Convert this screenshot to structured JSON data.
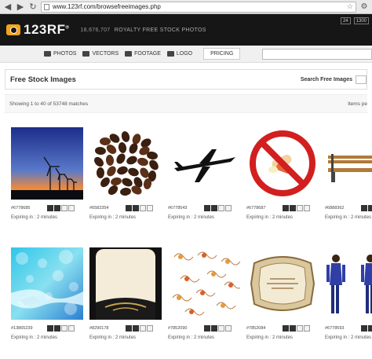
{
  "browser": {
    "url": "www.123rf.com/browsefreeimages.php"
  },
  "header": {
    "logo_text": "123RF",
    "logo_mark": "®",
    "stock_count": "18,676,707",
    "tagline": "ROYALTY FREE STOCK PHOTOS",
    "right_box_1": "24",
    "right_box_2": "1300"
  },
  "nav": {
    "items": [
      {
        "label": "PHOTOS",
        "icon": "camera-icon"
      },
      {
        "label": "VECTORS",
        "icon": "vector-icon"
      },
      {
        "label": "FOOTAGE",
        "icon": "film-icon"
      },
      {
        "label": "LOGO",
        "icon": "logo-icon"
      }
    ],
    "pricing": "PRICING"
  },
  "page": {
    "title": "Free Stock Images",
    "search_label": "Search Free Images",
    "results_text": "Showing 1 to 40 of 53748 matches",
    "items_per_page": "Items pe"
  },
  "images": [
    {
      "id": "#6778685",
      "expire": "Expiring in : 2 minutes",
      "kind": "wind-turbines"
    },
    {
      "id": "#6582354",
      "expire": "Expiring in : 2 minutes",
      "kind": "coffee-beans"
    },
    {
      "id": "#6778543",
      "expire": "Expiring in : 2 minutes",
      "kind": "airplane"
    },
    {
      "id": "#6778687",
      "expire": "Expiring in : 2 minutes",
      "kind": "no-pills"
    },
    {
      "id": "#6888362",
      "expire": "Expiring in : 2 minutes",
      "kind": "bench"
    },
    {
      "id": "#13865239",
      "expire": "Expiring in : 2 minutes",
      "kind": "bokeh-blue"
    },
    {
      "id": "#8290178",
      "expire": "Expiring in : 2 minutes",
      "kind": "gold-frame"
    },
    {
      "id": "#7852090",
      "expire": "Expiring in : 2 minutes",
      "kind": "floral"
    },
    {
      "id": "#7852084",
      "expire": "Expiring in : 2 minutes",
      "kind": "vintage-label"
    },
    {
      "id": "#6778593",
      "expire": "Expiring in : 2 minutes",
      "kind": "businesswomen"
    }
  ],
  "action_icons": [
    "S",
    "G",
    "F",
    "B"
  ],
  "colors": {
    "header_bg": "#161616",
    "logo_accent": "#f3a41c",
    "no_sign_red": "#d21f1f"
  }
}
